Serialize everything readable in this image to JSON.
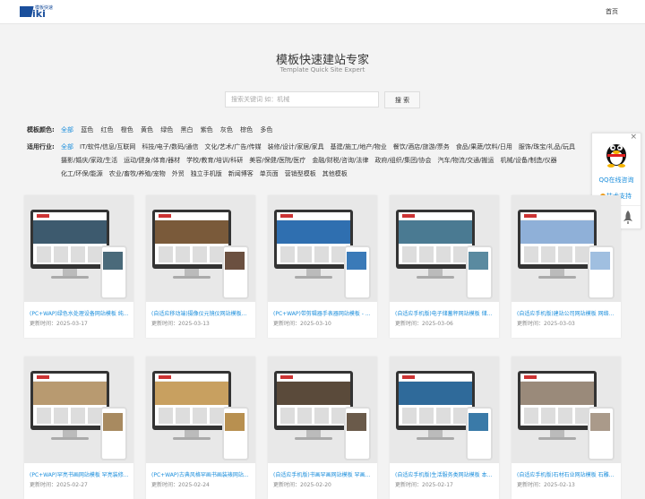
{
  "header": {
    "logo_text": "Viki",
    "logo_sub": "模板快速",
    "nav_home": "首页"
  },
  "hero": {
    "title": "模板快速建站专家",
    "subtitle": "Template Quick Site Expert",
    "search_placeholder": "搜索关键词 如：机械",
    "search_button": "搜 索"
  },
  "colors_filter": {
    "label": "模板颜色:",
    "items": [
      "全部",
      "蓝色",
      "红色",
      "橙色",
      "黄色",
      "绿色",
      "黑白",
      "紫色",
      "灰色",
      "棕色",
      "多色"
    ]
  },
  "industry_filter": {
    "label": "适用行业:",
    "items": [
      "全部",
      "IT/软件/信息/互联网",
      "科技/电子/数码/通信",
      "文化/艺术/广告/传媒",
      "装修/设计/家居/家具",
      "基建/施工/地产/物业",
      "餐饮/酒店/旅游/票务",
      "食品/果蔬/饮料/日用",
      "服饰/珠宝/礼品/玩具",
      "摄影/婚庆/家政/生活",
      "运动/健身/体育/器材",
      "学校/教育/培训/科研",
      "美容/保健/医院/医疗",
      "金融/财税/咨询/法律",
      "政府/组织/集团/协会",
      "汽车/物流/交通/搬运",
      "机械/设备/制造/仪器",
      "化工/环保/能源",
      "农业/畜牧/养殖/宠物",
      "外贸",
      "独立手机版",
      "新闻博客",
      "单页面",
      "营销型模板",
      "其他模板"
    ]
  },
  "qq_widget": {
    "close": "×",
    "online": "QQ在线咨询",
    "tech": "技术支持"
  },
  "accent_color": "#1d8fdc",
  "cards": [
    {
      "title": "(PC+WAP)绿色水处理设备网站模板 纯...",
      "date": "更新时间：2025-03-17",
      "banner": "#3d5a6e",
      "phone": "#4a6a7a"
    },
    {
      "title": "(自适应移动端)摄像仪元镜仪网站模板...",
      "date": "更新时间：2025-03-13",
      "banner": "#7a5a3a",
      "phone": "#6b5040"
    },
    {
      "title": "(PC+WAP)带剪辑器手表器网站模板 - ...",
      "date": "更新时间：2025-03-10",
      "banner": "#2f6fb0",
      "phone": "#3a7ab8"
    },
    {
      "title": "(自适应手机版)电子储蓄秤网站模板 储...",
      "date": "更新时间：2025-03-06",
      "banner": "#4a7a92",
      "phone": "#5a8aa0"
    },
    {
      "title": "(自适应手机版)建站公司网站模板 网络...",
      "date": "更新时间：2025-03-03",
      "banner": "#8fb0d8",
      "phone": "#a0bfe0"
    },
    {
      "title": "(PC+WAP)罕亮书画网站模板 罕亮装修...",
      "date": "更新时间：2025-02-27",
      "banner": "#b89a70",
      "phone": "#a88a60"
    },
    {
      "title": "(PC+WAP)古典风格罕画书画装裱网站...",
      "date": "更新时间：2025-02-24",
      "banner": "#c8a060",
      "phone": "#b89050"
    },
    {
      "title": "(自适应手机版)书画罕画网站模板 罕画...",
      "date": "更新时间：2025-02-20",
      "banner": "#5a4a3a",
      "phone": "#6a5a4a"
    },
    {
      "title": "(自适应手机版)生活服务类网站模板 本...",
      "date": "更新时间：2025-02-17",
      "banner": "#2f6a9a",
      "phone": "#3a7aa8"
    },
    {
      "title": "(自适应手机版)石材石业网站模板 石雕...",
      "date": "更新时间：2025-02-13",
      "banner": "#9a8a7a",
      "phone": "#aa9a8a"
    }
  ]
}
